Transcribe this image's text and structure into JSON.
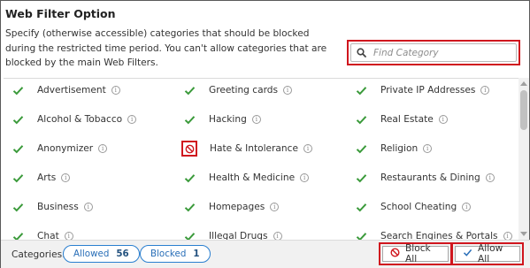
{
  "panel": {
    "title": "Web Filter Option",
    "description": "Specify (otherwise accessible) categories that should be blocked during the restricted time period. You can't allow categories that are blocked by the main Web Filters."
  },
  "search": {
    "placeholder": "Find Category",
    "icon": "search-icon"
  },
  "categories": [
    {
      "label": "Advertisement",
      "state": "allowed"
    },
    {
      "label": "Greeting cards",
      "state": "allowed"
    },
    {
      "label": "Private IP Addresses",
      "state": "allowed"
    },
    {
      "label": "Alcohol & Tobacco",
      "state": "allowed"
    },
    {
      "label": "Hacking",
      "state": "allowed"
    },
    {
      "label": "Real Estate",
      "state": "allowed"
    },
    {
      "label": "Anonymizer",
      "state": "allowed"
    },
    {
      "label": "Hate & Intolerance",
      "state": "blocked"
    },
    {
      "label": "Religion",
      "state": "allowed"
    },
    {
      "label": "Arts",
      "state": "allowed"
    },
    {
      "label": "Health & Medicine",
      "state": "allowed"
    },
    {
      "label": "Restaurants & Dining",
      "state": "allowed"
    },
    {
      "label": "Business",
      "state": "allowed"
    },
    {
      "label": "Homepages",
      "state": "allowed"
    },
    {
      "label": "School Cheating",
      "state": "allowed"
    },
    {
      "label": "Chat",
      "state": "allowed"
    },
    {
      "label": "Illegal Drugs",
      "state": "allowed"
    },
    {
      "label": "Search Engines & Portals",
      "state": "allowed"
    }
  ],
  "info_glyph": "i",
  "footer": {
    "categories_label": "Categories:",
    "allowed_label": "Allowed",
    "allowed_count": "56",
    "blocked_label": "Blocked",
    "blocked_count": "1",
    "block_all_label": "Block All",
    "allow_all_label": "Allow All"
  },
  "colors": {
    "check": "#3a9a3a",
    "blocked": "#d0161e",
    "highlight": "#d0161e",
    "pill_border": "#2a7fd0"
  }
}
